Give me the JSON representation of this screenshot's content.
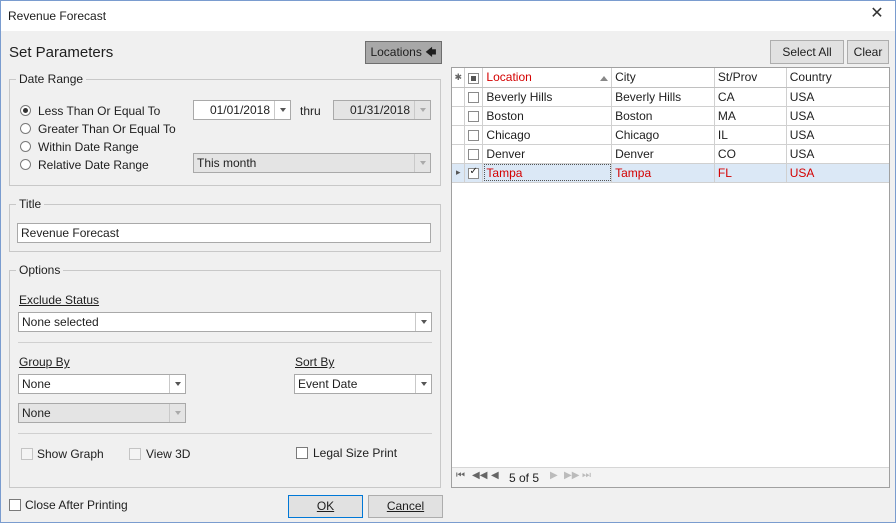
{
  "window": {
    "title": "Revenue Forecast",
    "close_glyph": "✕"
  },
  "header": {
    "title": "Set Parameters",
    "locations_label": "Locations",
    "locations_arrow": "🡄"
  },
  "date_range": {
    "group_label": "Date Range",
    "options": [
      "Less Than Or Equal To",
      "Greater Than Or Equal To",
      "Within Date Range",
      "Relative Date Range"
    ],
    "selected_index": 0,
    "from_value": "01/01/2018",
    "thru_label": "thru",
    "to_value": "01/31/2018",
    "relative_value": "This month"
  },
  "title_group": {
    "group_label": "Title",
    "value": "Revenue Forecast"
  },
  "options_group": {
    "group_label": "Options",
    "exclude_status_label": "Exclude Status",
    "exclude_status_value": "None selected",
    "group_by_label": "Group By",
    "group_by_value": "None",
    "group_by_sub_value": "None",
    "sort_by_label": "Sort By",
    "sort_by_value": "Event Date",
    "show_graph_label": "Show Graph",
    "view_3d_label": "View 3D",
    "legal_size_label": "Legal Size Print"
  },
  "footer": {
    "close_after_label": "Close After Printing",
    "ok_label": "OK",
    "cancel_label": "Cancel"
  },
  "toolbar": {
    "select_all_label": "Select All",
    "clear_label": "Clear"
  },
  "table": {
    "header_indicator": "✱",
    "columns": [
      "Location",
      "City",
      "St/Prov",
      "Country"
    ],
    "rows": [
      {
        "location": "Beverly Hills",
        "city": "Beverly Hills",
        "state": "CA",
        "country": "USA",
        "checked": false
      },
      {
        "location": "Boston",
        "city": "Boston",
        "state": "MA",
        "country": "USA",
        "checked": false
      },
      {
        "location": "Chicago",
        "city": "Chicago",
        "state": "IL",
        "country": "USA",
        "checked": false
      },
      {
        "location": "Denver",
        "city": "Denver",
        "state": "CO",
        "country": "USA",
        "checked": false
      },
      {
        "location": "Tampa",
        "city": "Tampa",
        "state": "FL",
        "country": "USA",
        "checked": true
      }
    ],
    "current_row_marker": "▸"
  },
  "pager": {
    "first": "⏮",
    "prev_page": "◀◀",
    "prev": "◀",
    "status": "5 of 5",
    "next": "▶",
    "next_page": "▶▶",
    "last": "⏭"
  },
  "colors": {
    "selected_row_bg": "#dbe8f6",
    "selected_text": "#d40000",
    "accent_border": "#0078d7"
  }
}
